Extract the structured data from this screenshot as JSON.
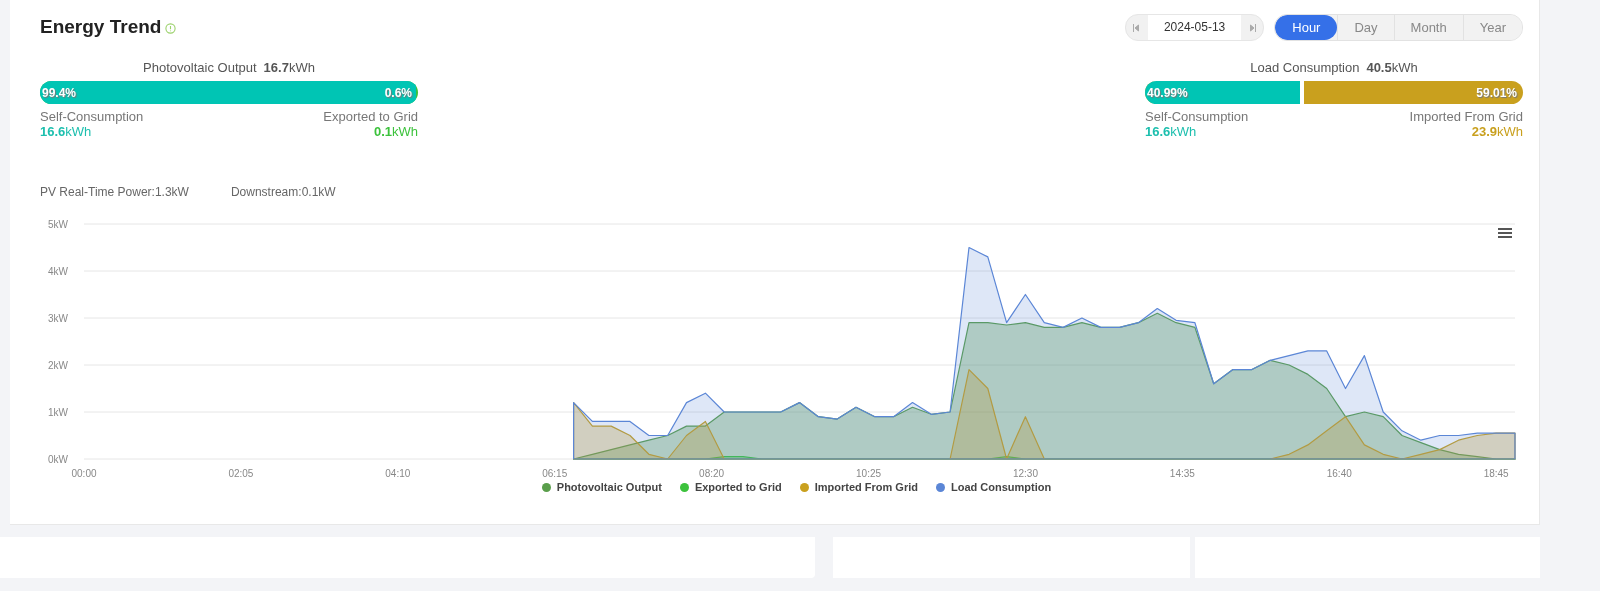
{
  "title": "Energy Trend",
  "date_picker": {
    "value": "2024-05-13"
  },
  "period_tabs": [
    {
      "label": "Hour",
      "selected": true
    },
    {
      "label": "Day",
      "selected": false
    },
    {
      "label": "Month",
      "selected": false
    },
    {
      "label": "Year",
      "selected": false
    }
  ],
  "pv_summary": {
    "label": "Photovoltaic Output",
    "value": "16.7",
    "unit": "kWh",
    "bar": {
      "level": 0.994,
      "left_label": "99.4%",
      "right_label": "0.6%"
    },
    "left": {
      "label": "Self-Consumption",
      "value": "16.6",
      "unit": "kWh"
    },
    "right": {
      "label": "Exported to Grid",
      "value": "0.1",
      "unit": "kWh"
    }
  },
  "load_summary": {
    "label": "Load Consumption",
    "value": "40.5",
    "unit": "kWh",
    "bar": {
      "level": 0.4099,
      "left_label": "40.99%",
      "right_label": "59.01%"
    },
    "left": {
      "label": "Self-Consumption",
      "value": "16.6",
      "unit": "kWh"
    },
    "right": {
      "label": "Imported From Grid",
      "value": "23.9",
      "unit": "kWh"
    }
  },
  "realtime": [
    "PV Real-Time Power:1.3kW",
    "Downstream:0.1kW"
  ],
  "chart_data": {
    "type": "area",
    "grid": true,
    "legend": true,
    "xlim": [
      0,
      1140
    ],
    "ylim": [
      0,
      5
    ],
    "xticks": [
      {
        "value": 0,
        "label": "00:00"
      },
      {
        "value": 125,
        "label": "02:05"
      },
      {
        "value": 250,
        "label": "04:10"
      },
      {
        "value": 375,
        "label": "06:15"
      },
      {
        "value": 500,
        "label": "08:20"
      },
      {
        "value": 625,
        "label": "10:25"
      },
      {
        "value": 750,
        "label": "12:30"
      },
      {
        "value": 875,
        "label": "14:35"
      },
      {
        "value": 1000,
        "label": "16:40"
      },
      {
        "value": 1125,
        "label": "18:45"
      }
    ],
    "yticks": [
      {
        "value": 0,
        "label": "0kW"
      },
      {
        "value": 1,
        "label": "1kW"
      },
      {
        "value": 2,
        "label": "2kW"
      },
      {
        "value": 3,
        "label": "3kW"
      },
      {
        "value": 4,
        "label": "4kW"
      },
      {
        "value": 5,
        "label": "5kW"
      }
    ],
    "x": [
      390,
      405,
      420,
      435,
      450,
      465,
      480,
      495,
      510,
      525,
      540,
      555,
      570,
      585,
      600,
      615,
      630,
      645,
      660,
      675,
      690,
      705,
      720,
      735,
      750,
      765,
      780,
      795,
      810,
      825,
      840,
      855,
      870,
      885,
      900,
      915,
      930,
      945,
      960,
      975,
      990,
      1005,
      1020,
      1035,
      1050,
      1065,
      1080,
      1095,
      1110,
      1125,
      1140
    ],
    "series": [
      {
        "name": "Photovoltaic Output",
        "color": "#5a9e4b",
        "values": [
          0,
          0.1,
          0.2,
          0.3,
          0.4,
          0.5,
          0.7,
          0.7,
          1.0,
          1.0,
          1.0,
          1.0,
          1.2,
          0.9,
          0.85,
          1.1,
          0.9,
          0.9,
          1.1,
          0.95,
          1.0,
          2.9,
          2.9,
          2.85,
          2.9,
          2.8,
          2.8,
          2.9,
          2.8,
          2.8,
          2.9,
          3.1,
          2.9,
          2.8,
          1.6,
          1.9,
          1.9,
          2.1,
          2.0,
          1.8,
          1.5,
          0.9,
          1.0,
          0.9,
          0.5,
          0.35,
          0.2,
          0.1,
          0.05,
          0,
          0
        ]
      },
      {
        "name": "Exported to Grid",
        "color": "#3cc23c",
        "values": [
          0,
          0,
          0,
          0,
          0,
          0,
          0,
          0,
          0.05,
          0.05,
          0,
          0,
          0,
          0,
          0,
          0,
          0,
          0,
          0,
          0,
          0,
          0,
          0,
          0.05,
          0,
          0,
          0,
          0,
          0,
          0,
          0,
          0,
          0,
          0,
          0,
          0,
          0,
          0,
          0,
          0,
          0,
          0,
          0,
          0,
          0,
          0,
          0,
          0,
          0,
          0,
          0
        ]
      },
      {
        "name": "Imported From Grid",
        "color": "#c9a01e",
        "values": [
          1.2,
          0.7,
          0.7,
          0.5,
          0.1,
          0,
          0.5,
          0.8,
          0,
          0,
          0,
          0,
          0,
          0,
          0,
          0,
          0,
          0,
          0,
          0,
          0,
          1.9,
          1.5,
          0,
          0.9,
          0,
          0,
          0,
          0,
          0,
          0,
          0,
          0,
          0,
          0,
          0,
          0,
          0,
          0.1,
          0.3,
          0.6,
          0.9,
          0.3,
          0.1,
          0,
          0.1,
          0.2,
          0.4,
          0.5,
          0.55,
          0.55
        ]
      },
      {
        "name": "Load Consumption",
        "color": "#5b86d6",
        "values": [
          1.2,
          0.8,
          0.8,
          0.8,
          0.5,
          0.5,
          1.2,
          1.4,
          1.0,
          1.0,
          1.0,
          1.0,
          1.2,
          0.9,
          0.85,
          1.1,
          0.9,
          0.9,
          1.2,
          0.95,
          1.0,
          4.5,
          4.3,
          2.9,
          3.5,
          2.9,
          2.8,
          3.0,
          2.8,
          2.8,
          2.9,
          3.2,
          2.95,
          2.9,
          1.6,
          1.9,
          1.9,
          2.1,
          2.2,
          2.3,
          2.3,
          1.5,
          2.2,
          1.0,
          0.6,
          0.4,
          0.5,
          0.5,
          0.55,
          0.55,
          0.55
        ]
      }
    ]
  }
}
